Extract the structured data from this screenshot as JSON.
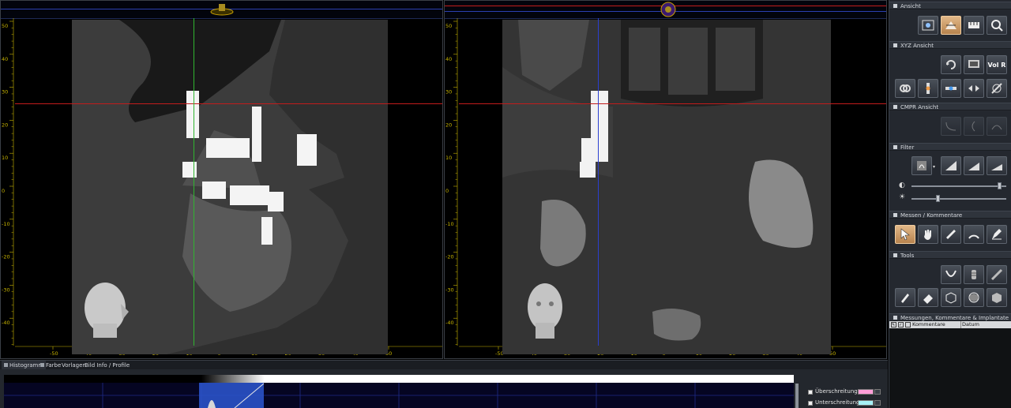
{
  "viewers": {
    "left": {
      "x_ticks": [
        "-50",
        "-40",
        "-30",
        "-20",
        "-10",
        "0",
        "10",
        "20",
        "30",
        "40",
        "50"
      ],
      "y_ticks": [
        "50",
        "40",
        "30",
        "20",
        "10",
        "0",
        "-10",
        "-20",
        "-30",
        "-40"
      ]
    },
    "right": {
      "x_ticks": [
        "-50",
        "-40",
        "-30",
        "-20",
        "-10",
        "0",
        "10",
        "20",
        "30",
        "40",
        "50"
      ],
      "y_ticks": [
        "50",
        "40",
        "30",
        "20",
        "10",
        "0",
        "-10",
        "-20",
        "-30",
        "-40"
      ]
    }
  },
  "panel": {
    "sections": {
      "ansicht": "Ansicht",
      "xyz": "XYZ Ansicht",
      "cmpr": "CMPR Ansicht",
      "filter": "Filter",
      "messen": "Messen / Kommentare",
      "tools": "Tools",
      "messungen": "Messungen, Kommentare & Implantate"
    },
    "vol_r_label": "Vol R",
    "table": {
      "col_kommentare": "Kommentare",
      "col_datum": "Datum"
    }
  },
  "bottom": {
    "tabs": [
      "Histogramm",
      "Farbe",
      "Vorlagen",
      "Bild Info / Profile"
    ],
    "ueberschreitung": "Überschreitung",
    "unterschreitung": "Unterschreitung",
    "colors": {
      "ueberschreitung": "#ff9ed8",
      "unterschreitung": "#a6f0f5"
    }
  }
}
